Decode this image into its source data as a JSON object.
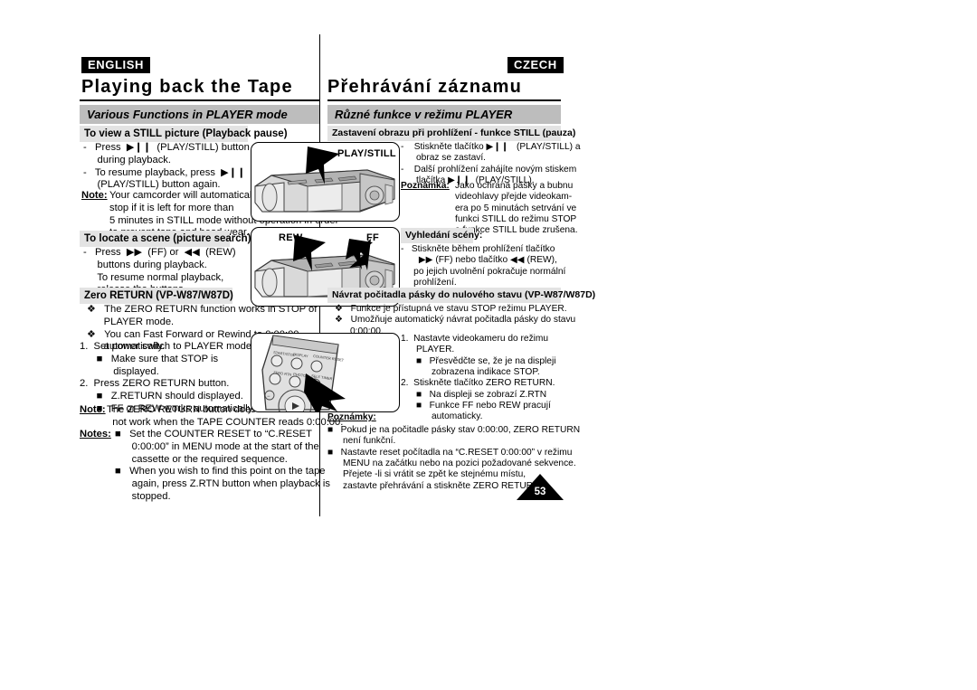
{
  "page": {
    "number": "53"
  },
  "left": {
    "language_badge": "ENGLISH",
    "title": "Playing back the Tape",
    "section_bar": "Various Functions in PLAYER mode",
    "subhead_still": "To view a STILL picture (Playback pause)",
    "still_body_1": "-   Press  ▶❙❙  (PLAY/STILL) button\n     during playback.\n-   To resume playback, press  ▶❙❙\n     (PLAY/STILL) button again.",
    "note_label": "Note:",
    "note_body": "Your camcorder will automatically\nstop if it is left for more than\n5 minutes in STILL mode without operation in order\nto prevent tape and head wear.",
    "subhead_locate": "To locate a scene (picture search)",
    "locate_body": "-   Press  ▶▶  (FF) or  ◀◀  (REW)\n     buttons during playback.\n     To resume normal playback,\n     release the buttons.",
    "subhead_zero": "Zero RETURN (VP-W87/W87D)",
    "zero_bullets": "❖   The ZERO RETURN function works in STOP of\n      PLAYER mode.\n❖   You can Fast Forward or Rewind to 0:00:00\n      automatically.",
    "zero_steps": "1.  Set power switch to PLAYER mode.\n      ■   Make sure that STOP is\n            displayed.\n2.  Press ZERO RETURN button.\n      ■   Z.RETURN should displayed.\n      ■   FF or REW works automatically.",
    "note2_label": "Note:",
    "note2_body": "The ZERO RETURN button does\n  not work when the TAPE COUNTER reads 0:00:00.",
    "notes_label": "Notes:",
    "notes_body": "■   Set the COUNTER RESET to “C.RESET\n      0:00:00” in MENU mode at the start of the\n      cassette or the required sequence.\n■   When you wish to find this point on the tape\n      again, press Z.RTN button when playback is\n      stopped."
  },
  "right": {
    "language_badge": "CZECH",
    "title": "Přehrávání záznamu",
    "section_bar": "Různé funkce v režimu PLAYER",
    "subhead_still": "Zastavení obrazu při prohlížení - funkce STILL (pauza)",
    "still_body": "-    Stiskněte tlačítko ▶❙❙   (PLAY/STILL) a\n      obraz se zastaví.\n-    Další prohlížení zahájíte novým stiskem\n      tlačítka ▶❙❙  (PLAY/STILL).",
    "note_label": "Poznámka:",
    "note_body": "Jako ochrana pásky a bubnu\nvideohlavy přejde videokam-\nera po 5 minutách setrvání ve\nfunkci STILL do režimu STOP\na funkce STILL bude zrušena.",
    "subhead_search": "Vyhledání scény:",
    "search_body": "-   Stiskněte během prohlížení tlačítko\n       ▶▶ (FF) nebo tlačítko ◀◀ (REW),\n     po jejich uvolnění pokračuje normální\n     prohlížení.",
    "subhead_zero": "Návrat počitadla pásky do nulového stavu (VP-W87/W87D)",
    "zero_bullets": "❖   Funkce je přístupná ve stavu STOP režimu PLAYER.\n❖   Umožňuje automatický návrat počitadla pásky do stavu\n      0:00:00.",
    "zero_steps": "1.  Nastavte videokameru do režimu\n      PLAYER.\n      ■   Přesvědčte se, že je na displeji\n            zobrazena indikace STOP.\n2.  Stiskněte tlačítko ZERO RETURN.\n      ■   Na displeji se zobrazí Z.RTN\n      ■   Funkce FF nebo REW pracují\n            automaticky.",
    "notes_label": "Poznámky:",
    "notes_body": "■   Pokud je na počitadle pásky stav 0:00:00, ZERO RETURN\n      není funkční.\n■   Nastavte reset počítadla na “C.RESET 0:00:00” v režimu\n      MENU na začátku nebo na pozici požadované sekvence.\n      Přejete -li si vrátit se zpět ke stejnému místu,\n      zastavte přehrávání a stiskněte ZERO RETURN."
  },
  "illustrations": {
    "cam_play_label": "PLAY/STILL",
    "cam_rew_label": "REW",
    "cam_ff_label": "FF",
    "remote_label": ""
  }
}
